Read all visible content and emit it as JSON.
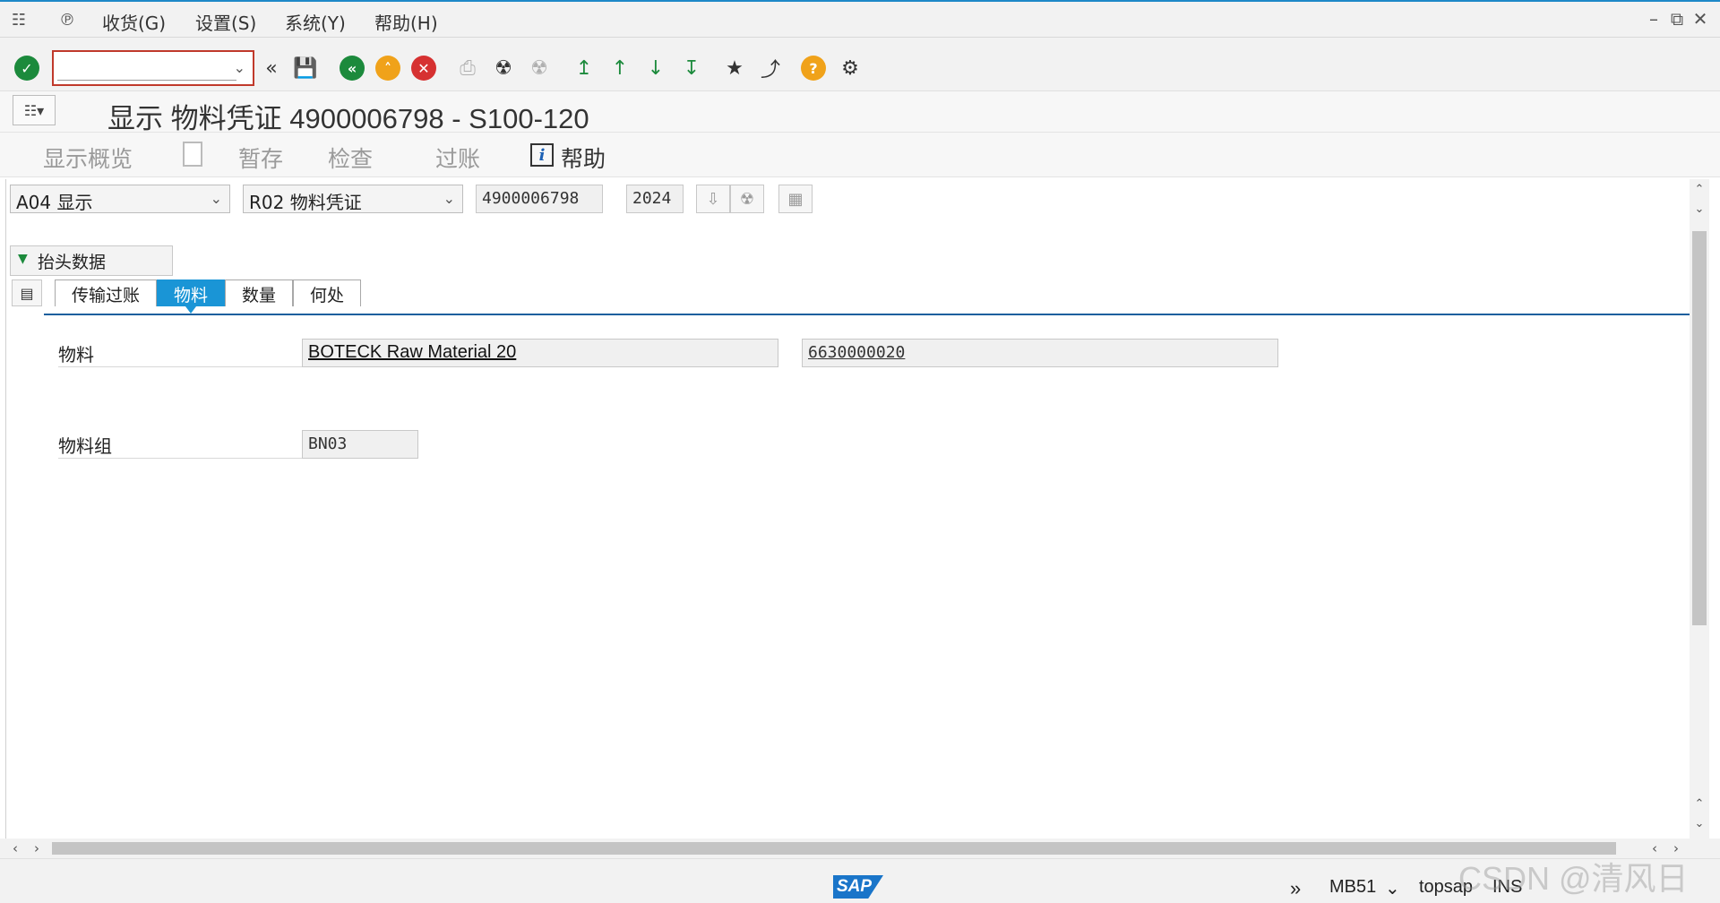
{
  "menubar": {
    "items": [
      "收货(G)",
      "设置(S)",
      "系统(Y)",
      "帮助(H)"
    ],
    "menu_icon": "menu-icon",
    "back_icon": "sap-menu-icon"
  },
  "toolbar": {
    "command_placeholder": "",
    "icons": [
      "enter-icon",
      "back-double-icon",
      "save-icon",
      "back-icon",
      "exit-icon",
      "cancel-icon",
      "print-icon",
      "find-icon",
      "find-next-icon",
      "first-page-icon",
      "previous-page-icon",
      "next-page-icon",
      "last-page-icon",
      "create-session-icon",
      "shortcut-icon",
      "help-icon",
      "customize-icon"
    ]
  },
  "title": {
    "text": "显示 物料凭证 4900006798 - S100-120"
  },
  "app_toolbar": {
    "overview": "显示概览",
    "hold": "暂存",
    "check": "检查",
    "post": "过账",
    "help": "帮助"
  },
  "selection": {
    "action": "A04 显示",
    "reference": "R02 物料凭证",
    "doc_number": "4900006798",
    "year": "2024"
  },
  "header_data_label": "抬头数据",
  "tabs": [
    "传输过账",
    "物料",
    "数量",
    "何处"
  ],
  "selected_tab": "物料",
  "material": {
    "label": "物料",
    "description": "BOTECK Raw Material 20",
    "number": "6630000020"
  },
  "material_group": {
    "label": "物料组",
    "value": "BN03"
  },
  "statusbar": {
    "logo": "SAP",
    "transaction": "MB51",
    "system": "topsap",
    "mode": "INS"
  },
  "watermark": "CSDN @清风日下",
  "colors": {
    "accent": "#1a95d6",
    "enter_green": "#1c8a3c",
    "exit_orange": "#f0a21a",
    "cancel_red": "#d63131",
    "help_yellow": "#f0a21a"
  }
}
